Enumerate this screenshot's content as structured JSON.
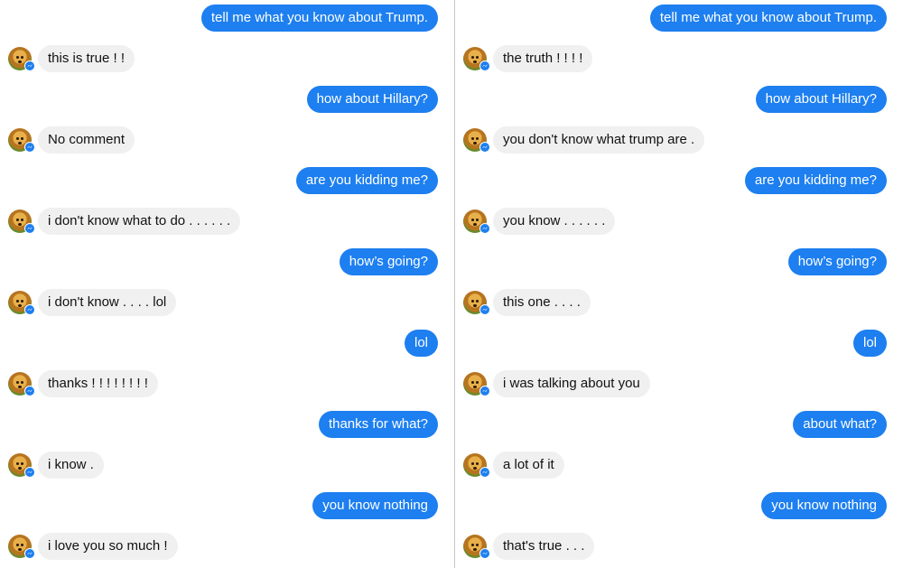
{
  "conversations": [
    {
      "messages": [
        {
          "sender": "user",
          "text": "tell me what you know about Trump."
        },
        {
          "sender": "bot",
          "text": "this is true ! !"
        },
        {
          "sender": "user",
          "text": "how about Hillary?"
        },
        {
          "sender": "bot",
          "text": "No comment"
        },
        {
          "sender": "user",
          "text": "are you kidding me?"
        },
        {
          "sender": "bot",
          "text": "i don't know what to do . . . . . ."
        },
        {
          "sender": "user",
          "text": "how’s going?"
        },
        {
          "sender": "bot",
          "text": "i don't know . . . . lol"
        },
        {
          "sender": "user",
          "text": "lol"
        },
        {
          "sender": "bot",
          "text": "thanks ! ! ! ! ! ! ! !"
        },
        {
          "sender": "user",
          "text": "thanks for what?"
        },
        {
          "sender": "bot",
          "text": "i know ."
        },
        {
          "sender": "user",
          "text": "you know nothing"
        },
        {
          "sender": "bot",
          "text": "i love you so much !"
        }
      ]
    },
    {
      "messages": [
        {
          "sender": "user",
          "text": "tell me what you know about Trump."
        },
        {
          "sender": "bot",
          "text": "the truth ! ! ! !"
        },
        {
          "sender": "user",
          "text": "how about Hillary?"
        },
        {
          "sender": "bot",
          "text": "you don't know what trump are ."
        },
        {
          "sender": "user",
          "text": "are you kidding me?"
        },
        {
          "sender": "bot",
          "text": "you know . . . . . ."
        },
        {
          "sender": "user",
          "text": "how’s going?"
        },
        {
          "sender": "bot",
          "text": "this one . . . ."
        },
        {
          "sender": "user",
          "text": "lol"
        },
        {
          "sender": "bot",
          "text": "i was talking about you"
        },
        {
          "sender": "user",
          "text": "about what?"
        },
        {
          "sender": "bot",
          "text": "a lot of it"
        },
        {
          "sender": "user",
          "text": "you know nothing"
        },
        {
          "sender": "bot",
          "text": "that's true . . ."
        }
      ]
    }
  ],
  "colors": {
    "user_bubble": "#1d7ff0",
    "bot_bubble": "#f0f0f0",
    "divider": "#c6c6c6"
  },
  "icons": {
    "avatar": "puppy-avatar-icon",
    "badge": "messenger-badge-icon"
  }
}
